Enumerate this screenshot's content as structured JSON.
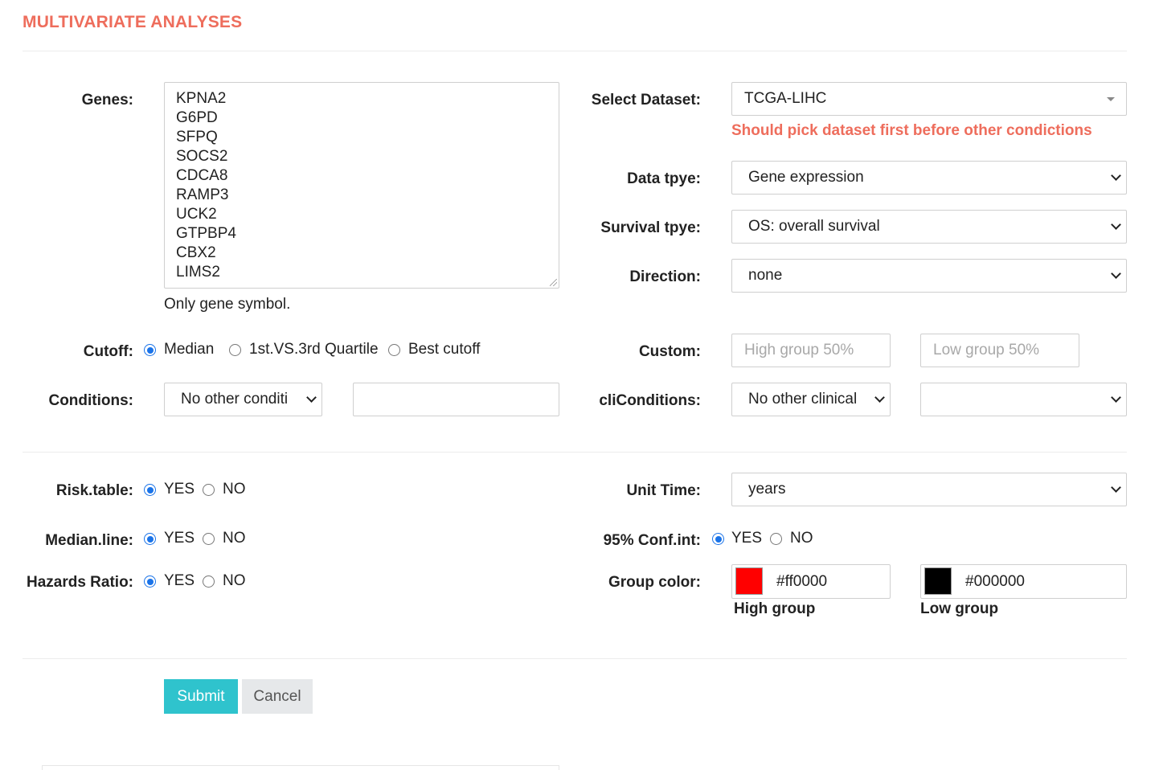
{
  "header": {
    "title": "MULTIVARIATE ANALYSES"
  },
  "genes": {
    "label": "Genes:",
    "list": [
      "KPNA2",
      "G6PD",
      "SFPQ",
      "SOCS2",
      "CDCA8",
      "RAMP3",
      "UCK2",
      "GTPBP4",
      "CBX2",
      "LIMS2"
    ],
    "hint": "Only gene symbol."
  },
  "dataset": {
    "label": "Select Dataset:",
    "value": "TCGA-LIHC",
    "warning": "Should pick dataset first before other condictions"
  },
  "data_type": {
    "label": "Data tpye:",
    "value": "Gene expression"
  },
  "survival_type": {
    "label": "Survival tpye:",
    "value": "OS: overall survival"
  },
  "direction": {
    "label": "Direction:",
    "value": "none"
  },
  "cutoff": {
    "label": "Cutoff:",
    "options": [
      "Median",
      "1st.VS.3rd Quartile",
      "Best cutoff"
    ],
    "selected": "Median"
  },
  "custom": {
    "label": "Custom:",
    "high_placeholder": "High group 50%",
    "low_placeholder": "Low group 50%"
  },
  "conditions": {
    "label": "Conditions:",
    "value": "No other conditi",
    "text_value": ""
  },
  "cli_conditions": {
    "label": "cliConditions:",
    "value": "No other clinical",
    "second_value": ""
  },
  "risk_table": {
    "label": "Risk.table:",
    "yes": "YES",
    "no": "NO",
    "selected": "YES"
  },
  "median_line": {
    "label": "Median.line:",
    "yes": "YES",
    "no": "NO",
    "selected": "YES"
  },
  "hazards_ratio": {
    "label": "Hazards Ratio:",
    "yes": "YES",
    "no": "NO",
    "selected": "YES"
  },
  "unit_time": {
    "label": "Unit Time:",
    "value": "years"
  },
  "conf_int": {
    "label": "95% Conf.int:",
    "yes": "YES",
    "no": "NO",
    "selected": "YES"
  },
  "group_color": {
    "label": "Group color:",
    "high": {
      "hex": "#ff0000",
      "caption": "High group"
    },
    "low": {
      "hex": "#000000",
      "caption": "Low group"
    }
  },
  "actions": {
    "submit": "Submit",
    "cancel": "Cancel"
  }
}
